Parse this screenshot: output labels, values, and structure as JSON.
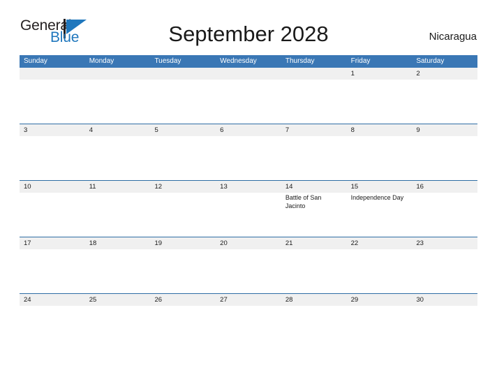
{
  "brand": {
    "name_part1": "General",
    "name_part2": "Blue",
    "flag_icon": "blue-flag-icon",
    "color_text": "#231f20",
    "color_blue": "#1f77bd"
  },
  "header": {
    "title": "September 2028",
    "region": "Nicaragua"
  },
  "theme": {
    "header_blue": "#3a77b5",
    "row_border_blue": "#2e6da4",
    "day_band_gray": "#f0f0f0",
    "text_dark": "#1a1a1a"
  },
  "calendar": {
    "month": "September",
    "year": "2028",
    "weekdays": [
      {
        "label": "Sunday"
      },
      {
        "label": "Monday"
      },
      {
        "label": "Tuesday"
      },
      {
        "label": "Wednesday"
      },
      {
        "label": "Thursday"
      },
      {
        "label": "Friday"
      },
      {
        "label": "Saturday"
      }
    ],
    "weeks": [
      {
        "days": [
          {
            "number": "",
            "events": []
          },
          {
            "number": "",
            "events": []
          },
          {
            "number": "",
            "events": []
          },
          {
            "number": "",
            "events": []
          },
          {
            "number": "",
            "events": []
          },
          {
            "number": "1",
            "events": []
          },
          {
            "number": "2",
            "events": []
          }
        ]
      },
      {
        "days": [
          {
            "number": "3",
            "events": []
          },
          {
            "number": "4",
            "events": []
          },
          {
            "number": "5",
            "events": []
          },
          {
            "number": "6",
            "events": []
          },
          {
            "number": "7",
            "events": []
          },
          {
            "number": "8",
            "events": []
          },
          {
            "number": "9",
            "events": []
          }
        ]
      },
      {
        "days": [
          {
            "number": "10",
            "events": []
          },
          {
            "number": "11",
            "events": []
          },
          {
            "number": "12",
            "events": []
          },
          {
            "number": "13",
            "events": []
          },
          {
            "number": "14",
            "events": [
              "Battle of San Jacinto"
            ]
          },
          {
            "number": "15",
            "events": [
              "Independence Day"
            ]
          },
          {
            "number": "16",
            "events": []
          }
        ]
      },
      {
        "days": [
          {
            "number": "17",
            "events": []
          },
          {
            "number": "18",
            "events": []
          },
          {
            "number": "19",
            "events": []
          },
          {
            "number": "20",
            "events": []
          },
          {
            "number": "21",
            "events": []
          },
          {
            "number": "22",
            "events": []
          },
          {
            "number": "23",
            "events": []
          }
        ]
      },
      {
        "days": [
          {
            "number": "24",
            "events": []
          },
          {
            "number": "25",
            "events": []
          },
          {
            "number": "26",
            "events": []
          },
          {
            "number": "27",
            "events": []
          },
          {
            "number": "28",
            "events": []
          },
          {
            "number": "29",
            "events": []
          },
          {
            "number": "30",
            "events": []
          }
        ]
      }
    ]
  }
}
